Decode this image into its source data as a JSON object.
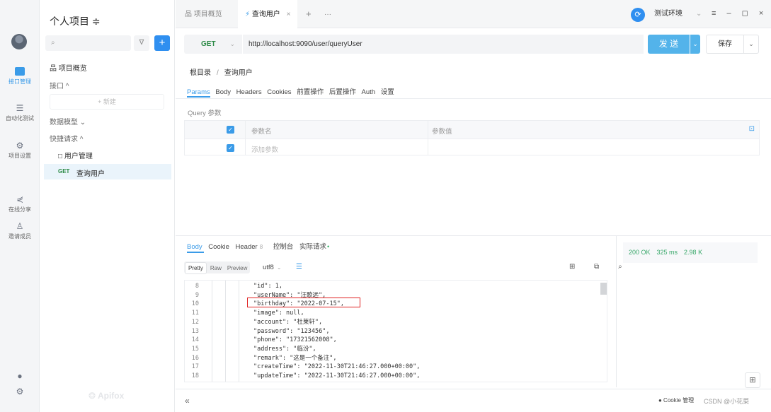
{
  "rail": {
    "items": [
      {
        "label": "接口管理",
        "icon": "api-icon"
      },
      {
        "label": "自动化测试",
        "icon": "automation-icon"
      },
      {
        "label": "项目设置",
        "icon": "settings-icon"
      },
      {
        "label": "在线分享",
        "icon": "share-icon"
      },
      {
        "label": "邀请成员",
        "icon": "invite-icon"
      }
    ]
  },
  "sidebar": {
    "project_title": "个人项目 ≑",
    "search_icon": "⌕",
    "filter_icon": "∇",
    "plus_icon": "+",
    "overview": "品 项目概览",
    "api_section": "接口 ^",
    "new_btn": "+ 新建",
    "schema": "数据模型 ⌄",
    "quick_request": "快捷请求 ^",
    "folder": "□ 用户管理",
    "selected_method": "GET",
    "selected_name": "查询用户",
    "brand": "Apifox"
  },
  "topbar": {
    "tab_overview": "品 项目概览",
    "tab_active_prefix": "⚡",
    "tab_active": "查询用户",
    "tab_close": "×",
    "tab_add": "+",
    "tab_more": "···",
    "env_icon": "⟳",
    "env_name": "测试环境",
    "env_caret": "⌄",
    "window_controls": "≡ – ◻ ×"
  },
  "request": {
    "method": "GET",
    "method_caret": "⌄",
    "url": "http://localhost:9090/user/queryUser",
    "send_label": "发 送",
    "send_drop": "⌄",
    "save_label": "保存",
    "save_drop": "⌄"
  },
  "breadcrumb": {
    "root": "根目录",
    "sep": "/",
    "current": "查询用户"
  },
  "param_tabs": [
    "Params",
    "Body",
    "Headers",
    "Cookies",
    "前置操作",
    "后置操作",
    "Auth",
    "设置"
  ],
  "query": {
    "label": "Query 参数",
    "header_name": "参数名",
    "header_value": "参数值",
    "add_placeholder": "添加参数",
    "check": "✓",
    "edit_icon": "⊡"
  },
  "response": {
    "tabs": [
      "Body",
      "Cookie",
      "Header",
      "控制台",
      "实际请求"
    ],
    "header_count": "8",
    "live_dot": "•",
    "formats": [
      "Pretty",
      "Raw",
      "Preview"
    ],
    "encoding": "utf8",
    "enc_caret": "⌄",
    "wrap_icon": "☰",
    "tool_icons": "⊞ ⧉ ⌕",
    "status": {
      "code": "200 OK",
      "time": "325 ms",
      "size": "2.98 K"
    },
    "expand_icon": "⊞",
    "code_lines": [
      {
        "n": "8",
        "t": "\"id\": 1,"
      },
      {
        "n": "9",
        "t": "\"userName\": \"汪歌远\","
      },
      {
        "n": "10",
        "t": "\"birthday\": \"2022-07-15\","
      },
      {
        "n": "11",
        "t": "\"image\": null,"
      },
      {
        "n": "12",
        "t": "\"account\": \"杜莱轩\","
      },
      {
        "n": "13",
        "t": "\"password\": \"123456\","
      },
      {
        "n": "14",
        "t": "\"phone\": \"17321562008\","
      },
      {
        "n": "15",
        "t": "\"address\": \"临汾\","
      },
      {
        "n": "16",
        "t": "\"remark\": \"这是一个备注\","
      },
      {
        "n": "17",
        "t": "\"createTime\": \"2022-11-30T21:46:27.000+00:00\","
      },
      {
        "n": "18",
        "t": "\"updateTime\": \"2022-11-30T21:46:27.000+00:00\","
      }
    ]
  },
  "footer": {
    "collapse": "«",
    "cookie_mgr": "● Cookie 管理",
    "watermark": "CSDN @小花菜",
    "icons": "⓪ ⊕"
  }
}
